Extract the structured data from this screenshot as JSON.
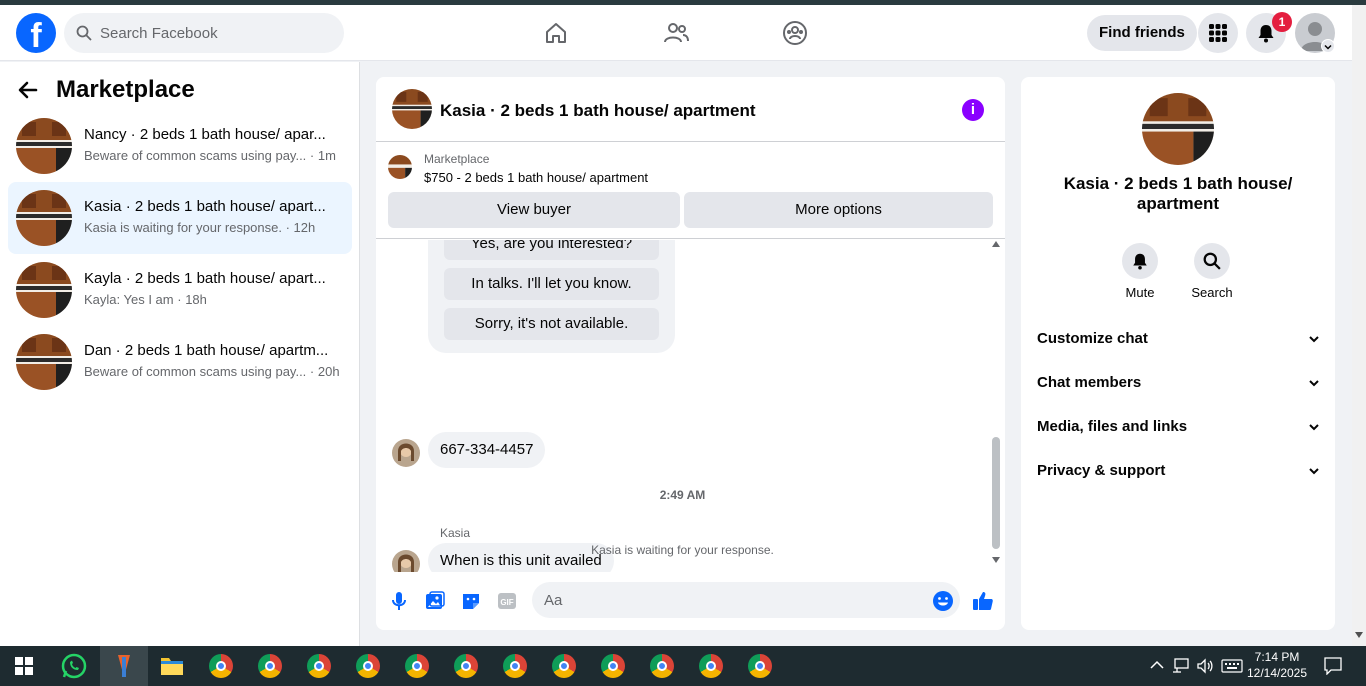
{
  "navbar": {
    "search_placeholder": "Search Facebook",
    "find_friends": "Find friends",
    "notification_count": "1"
  },
  "sidebar": {
    "title": "Marketplace",
    "conversations": [
      {
        "name": "Nancy · 2 beds 1 bath house/ apar...",
        "preview": "Beware of common scams using pay...",
        "time": "· 1m",
        "active": false
      },
      {
        "name": "Kasia · 2 beds 1 bath house/ apart...",
        "preview": "Kasia is waiting for your response.",
        "time": "· 12h",
        "active": true
      },
      {
        "name": "Kayla · 2 beds 1 bath house/ apart...",
        "preview": "Kayla: Yes I am",
        "time": "· 18h",
        "active": false
      },
      {
        "name": "Dan · 2 beds 1 bath house/ apartm...",
        "preview": "Beware of common scams using pay...",
        "time": "· 20h",
        "active": false
      }
    ]
  },
  "chat": {
    "title": "Kasia · 2 beds 1 bath house/ apartment",
    "listing_kind": "Marketplace",
    "listing_price": "$750 - 2 beds 1 bath house/ apartment",
    "view_buyer": "View buyer",
    "more_options": "More options",
    "quick_replies": [
      "Yes, are you interested?",
      "In talks. I'll let you know.",
      "Sorry, it's not available."
    ],
    "phone_message": "667-334-4457",
    "timestamp": "2:49 AM",
    "sender": "Kasia",
    "last_message": "When is this unit availed",
    "waiting": "Kasia is waiting for your response.",
    "input_placeholder": "Aa"
  },
  "details": {
    "title": "Kasia · 2 beds 1 bath house/ apartment",
    "mute": "Mute",
    "search": "Search",
    "sections": [
      "Customize chat",
      "Chat members",
      "Media, files and links",
      "Privacy & support"
    ]
  },
  "taskbar": {
    "time": "7:14 PM",
    "date": "12/14/2025"
  },
  "colors": {
    "brand": "#0866ff",
    "info_purple": "#8a00ff",
    "notification_red": "#e41e3f",
    "active_conversation": "#ebf5ff"
  }
}
